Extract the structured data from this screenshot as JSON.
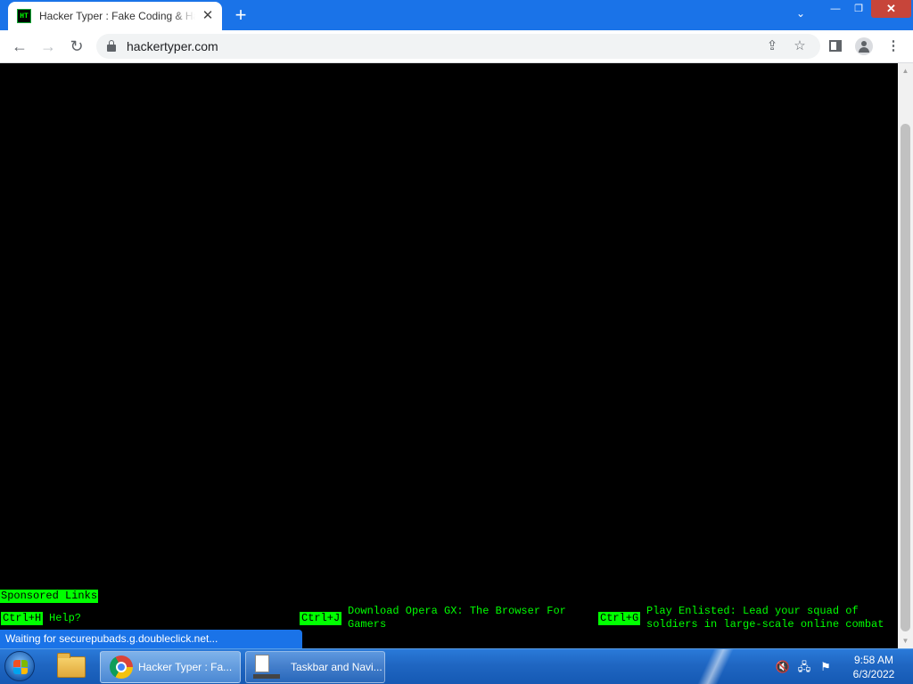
{
  "browser": {
    "tab": {
      "favicon": "HT",
      "title": "Hacker Typer : Fake Coding & Hacker Simulator"
    },
    "new_tab_symbol": "+",
    "tab_search_symbol": "⌄",
    "window_controls": {
      "minimize": "—",
      "maximize": "❐",
      "close": "✕"
    },
    "nav": {
      "back": "←",
      "forward": "→",
      "reload": "↻"
    },
    "url": "hackertyper.com",
    "icons": {
      "share": "share-icon",
      "bookmark": "star-icon",
      "side_panel": "side-panel-icon",
      "profile": "profile-icon",
      "menu": "⋮"
    }
  },
  "page": {
    "sponsored_label": "Sponsored Links",
    "hotkeys": [
      {
        "key": "Ctrl+H",
        "text": "Help?"
      },
      {
        "key": "Ctrl+J",
        "text": "Download Opera GX: The Browser For Gamers"
      },
      {
        "key": "Ctrl+G",
        "text": "Play Enlisted: Lead your squad of soldiers in large-scale online combat"
      }
    ],
    "status_bubble": "Waiting for securepubads.g.doubleclick.net..."
  },
  "taskbar": {
    "buttons": [
      {
        "label": "Hacker Typer : Fa..."
      },
      {
        "label": "Taskbar and Navi..."
      }
    ],
    "tray_icons": [
      "volume-muted-icon",
      "network-icon",
      "action-center-icon"
    ],
    "clock": {
      "time": "9:58 AM",
      "date": "6/3/2022"
    }
  },
  "colors": {
    "accent": "#1a73e8",
    "terminal_green": "#00ff00",
    "taskbar": "#1f66c2"
  }
}
